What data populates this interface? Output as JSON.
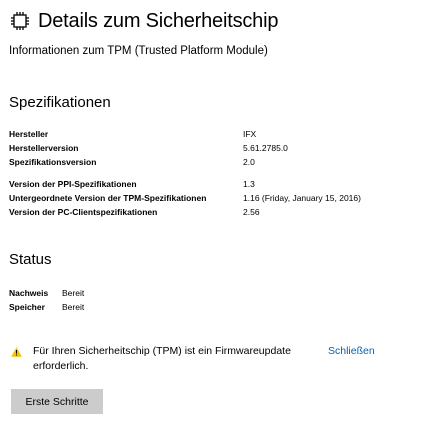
{
  "header": {
    "title": "Details zum Sicherheitschip",
    "subtitle": "Informationen zum TPM (Trusted Platform Module)",
    "icon": "chip-icon"
  },
  "specs": {
    "heading": "Spezifikationen",
    "rows": [
      {
        "label": "Hersteller",
        "value": "IFX"
      },
      {
        "label": "Herstellerversion",
        "value": "5.61.2785.0"
      },
      {
        "label": "Spezifikationsversion",
        "value": "2.0"
      },
      {
        "label": "Version der PPI-Spezifikationen",
        "value": "1.3"
      },
      {
        "label": "Untergeordnete Version der TPM-Spezifikationen",
        "value": "1.16 (Friday, January 15, 2016)"
      },
      {
        "label": "Version der PC-Clientspezifikationen",
        "value": "2.56"
      }
    ]
  },
  "status": {
    "heading": "Status",
    "rows": [
      {
        "label": "Nachweis",
        "value": "Bereit"
      },
      {
        "label": "Speicher",
        "value": "Bereit"
      }
    ]
  },
  "warning": {
    "icon": "warning-icon",
    "icon_color": "#f2c200",
    "text": "Für Ihren Sicherheitschip (TPM) ist ein Firmwareupdate erforderlich.",
    "link_label": "Schließen",
    "link_color": "#0063b1"
  },
  "actions": {
    "start_label": "Erste Schritte",
    "button_color": "#cccccc"
  }
}
